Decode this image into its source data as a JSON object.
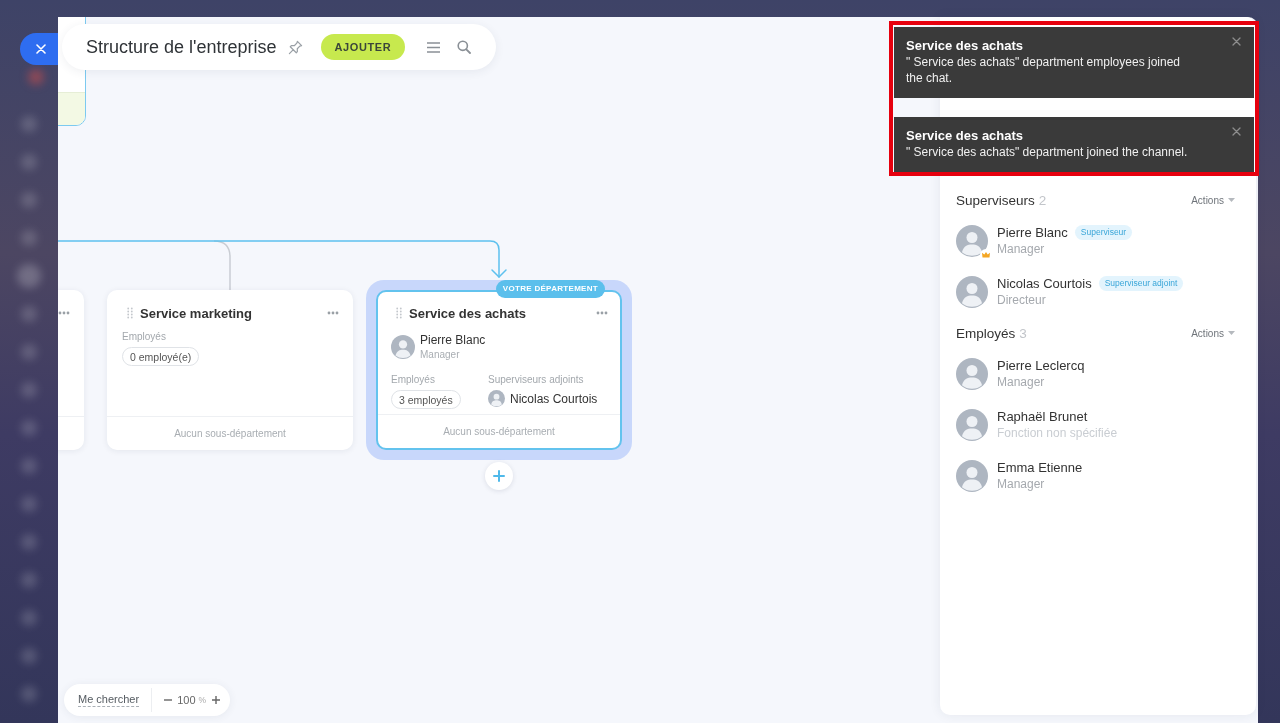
{
  "header": {
    "title": "Structure de l'entreprise",
    "add_button": "AJOUTER"
  },
  "org_chart": {
    "parent": {
      "kind": "cut_off"
    },
    "departments": [
      {
        "kind": "cut_off",
        "selected": false
      },
      {
        "kind": "full",
        "selected": false,
        "name": "Service marketing",
        "employees_label": "Employés",
        "employees_count": "0 employé(e)",
        "footer": "Aucun sous-département"
      },
      {
        "kind": "full",
        "selected": true,
        "badge": "VOTRE DÉPARTEMENT",
        "name": "Service des achats",
        "head": {
          "name": "Pierre Blanc",
          "role": "Manager"
        },
        "employees_label": "Employés",
        "employees_count": "3 employés",
        "deputies_label": "Superviseurs adjoints",
        "deputies": [
          {
            "name": "Nicolas Courtois"
          }
        ],
        "footer": "Aucun sous-département"
      }
    ]
  },
  "zoom_bar": {
    "find_me": "Me chercher",
    "zoom_value": "100",
    "zoom_unit": "%"
  },
  "panel": {
    "sections": [
      {
        "title": "Superviseurs",
        "count": "2",
        "actions": "Actions",
        "people": [
          {
            "name": "Pierre Blanc",
            "tag": "Superviseur",
            "role": "Manager",
            "role_specified": true,
            "crown": true
          },
          {
            "name": "Nicolas Courtois",
            "tag": "Superviseur adjoint",
            "role": "Directeur",
            "role_specified": true,
            "crown": false
          }
        ]
      },
      {
        "title": "Employés",
        "count": "3",
        "actions": "Actions",
        "people": [
          {
            "name": "Pierre Leclercq",
            "role": "Manager",
            "role_specified": true,
            "crown": false
          },
          {
            "name": "Raphaël Brunet",
            "role": "Fonction non spécifiée",
            "role_specified": false,
            "crown": false
          },
          {
            "name": "Emma Etienne",
            "role": "Manager",
            "role_specified": true,
            "crown": false
          }
        ]
      }
    ]
  },
  "toasts": [
    {
      "title": "Service des achats",
      "message": "\" Service des achats\" department employees joined the chat."
    },
    {
      "title": "Service des achats",
      "message": "\" Service des achats\" department joined the channel."
    }
  ]
}
